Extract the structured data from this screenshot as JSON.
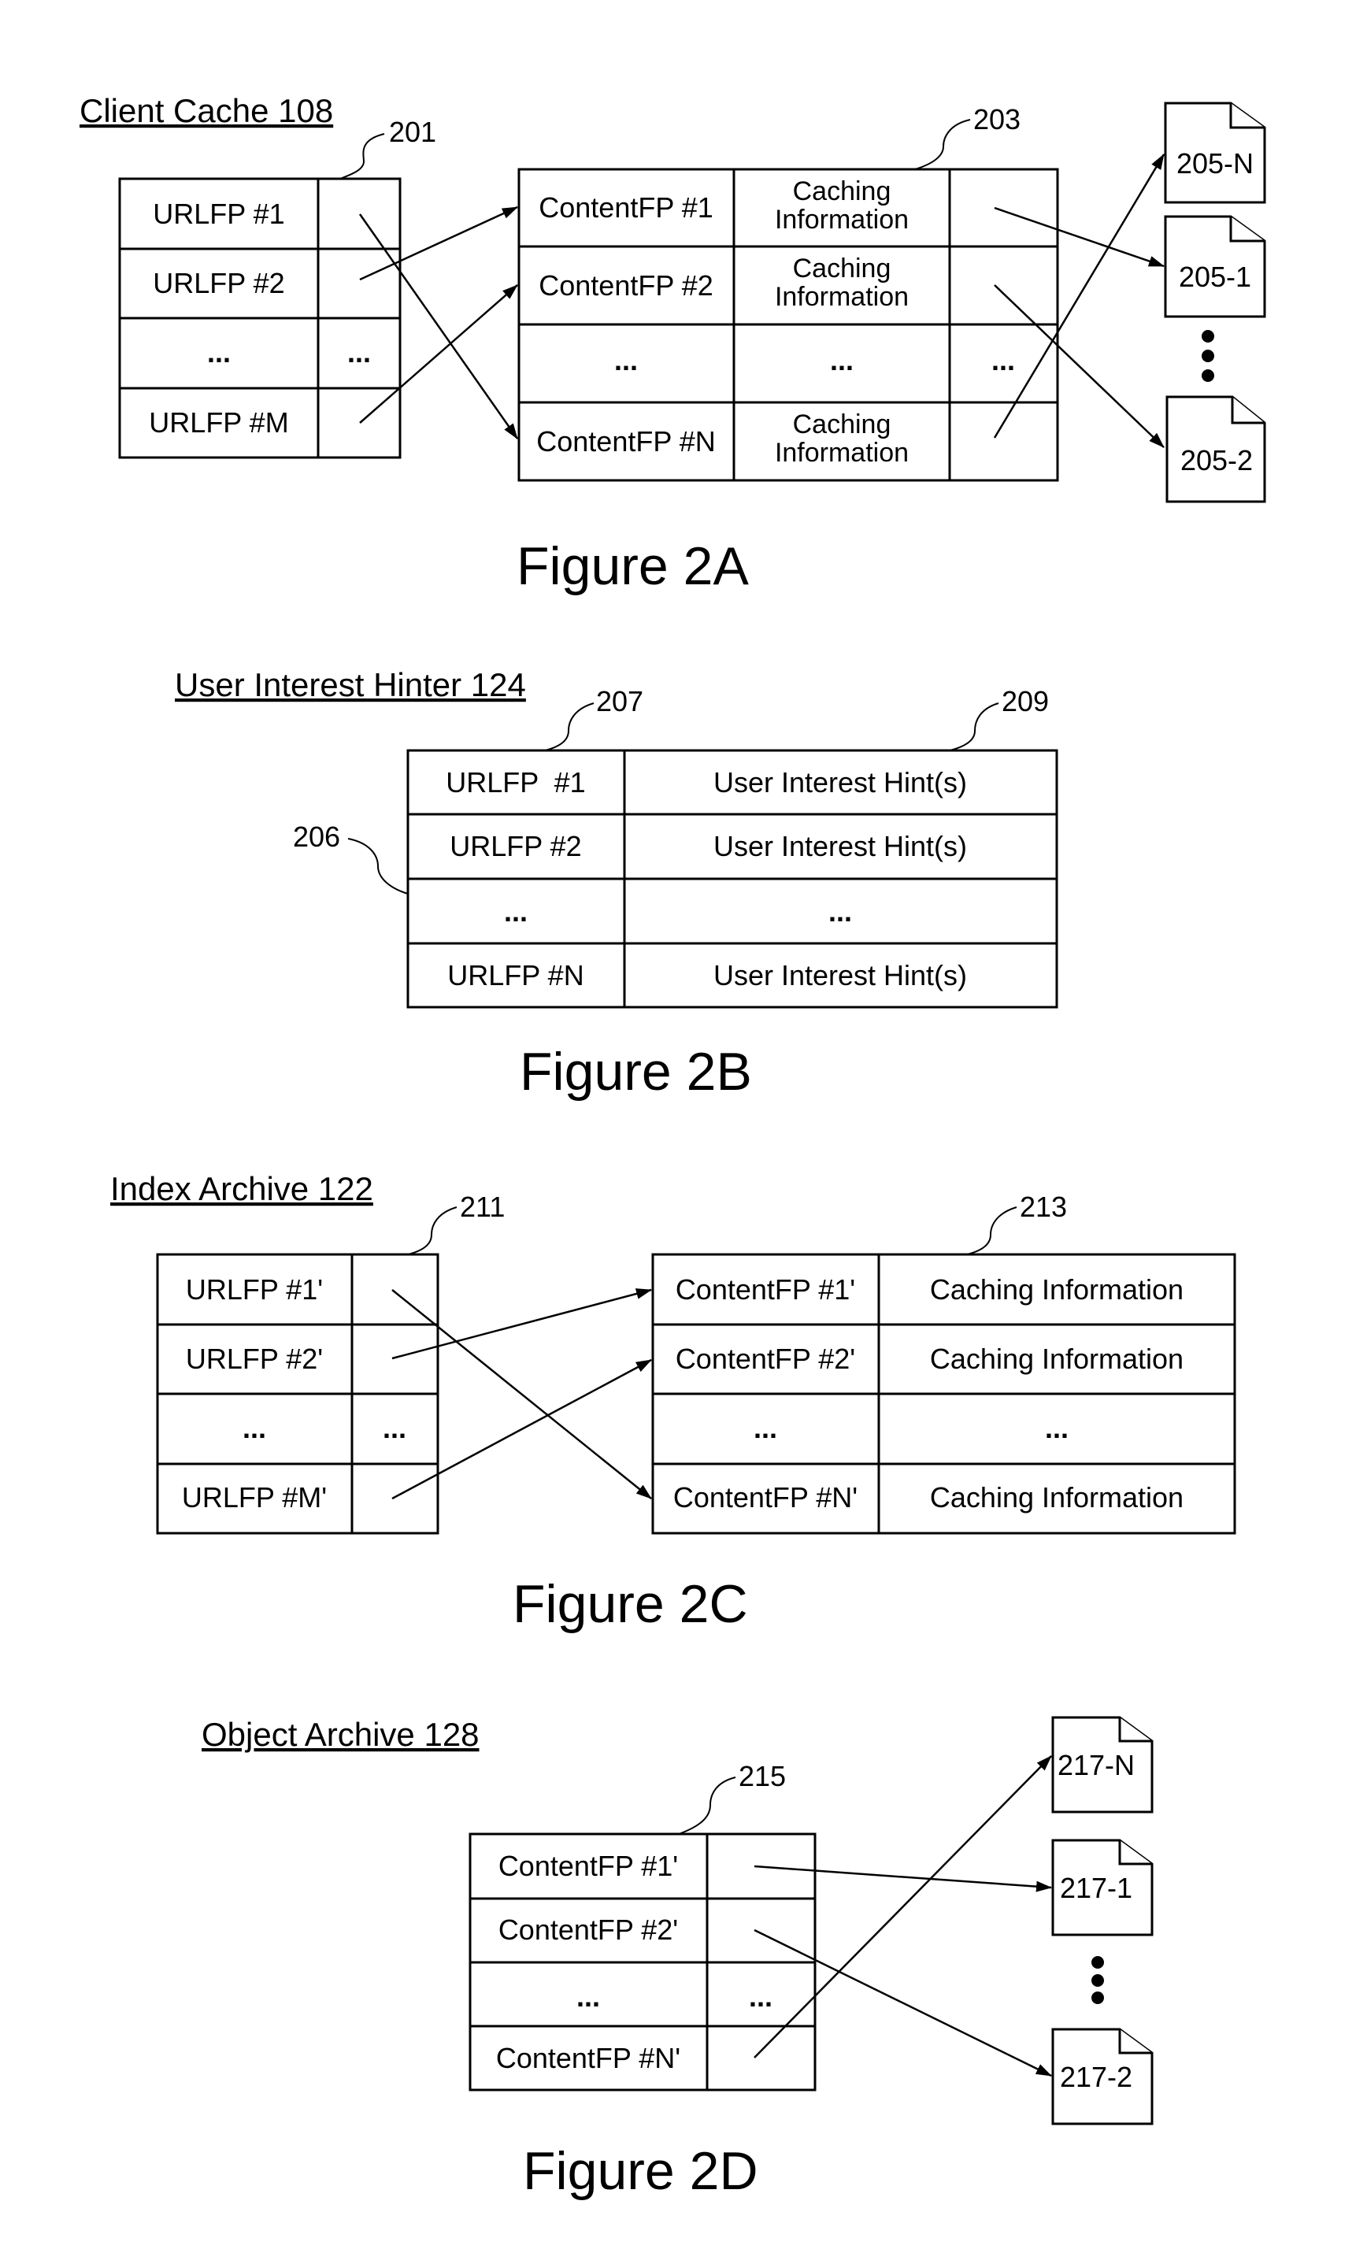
{
  "figure_2a": {
    "title": "Client Cache 108",
    "caption": "Figure 2A",
    "table_left": {
      "ref": "201",
      "rows": [
        {
          "key": "URLFP #1",
          "ptr": ""
        },
        {
          "key": "URLFP #2",
          "ptr": ""
        },
        {
          "key": "...",
          "ptr": "..."
        },
        {
          "key": "URLFP #M",
          "ptr": ""
        }
      ]
    },
    "table_right": {
      "ref": "203",
      "rows": [
        {
          "key": "ContentFP #1",
          "info": [
            "Caching",
            "Information"
          ],
          "ptr": ""
        },
        {
          "key": "ContentFP #2",
          "info": [
            "Caching",
            "Information"
          ],
          "ptr": ""
        },
        {
          "key": "...",
          "info": [
            "..."
          ],
          "ptr": "..."
        },
        {
          "key": "ContentFP #N",
          "info": [
            "Caching",
            "Information"
          ],
          "ptr": ""
        }
      ]
    },
    "documents": [
      "205-N",
      "205-1",
      "205-2"
    ],
    "mappings": [
      {
        "from": "URLFP #1",
        "to": "ContentFP #N"
      },
      {
        "from": "URLFP #2",
        "to": "ContentFP #1"
      },
      {
        "from": "URLFP #M",
        "to": "ContentFP #2"
      },
      {
        "from": "ContentFP #1",
        "to": "205-1"
      },
      {
        "from": "ContentFP #2",
        "to": "205-2"
      },
      {
        "from": "ContentFP #N",
        "to": "205-N"
      }
    ]
  },
  "figure_2b": {
    "title": "User Interest Hinter 124",
    "caption": "Figure 2B",
    "refs": {
      "row": "206",
      "col_key": "207",
      "col_hint": "209"
    },
    "rows": [
      {
        "key": "URLFP  #1",
        "hint": "User Interest Hint(s)"
      },
      {
        "key": "URLFP #2",
        "hint": "User Interest Hint(s)"
      },
      {
        "key": "...",
        "hint": "..."
      },
      {
        "key": "URLFP #N",
        "hint": "User Interest Hint(s)"
      }
    ]
  },
  "figure_2c": {
    "title": "Index Archive 122",
    "caption": "Figure 2C",
    "table_left": {
      "ref": "211",
      "rows": [
        {
          "key": "URLFP #1'",
          "ptr": ""
        },
        {
          "key": "URLFP #2'",
          "ptr": ""
        },
        {
          "key": "...",
          "ptr": "..."
        },
        {
          "key": "URLFP #M'",
          "ptr": ""
        }
      ]
    },
    "table_right": {
      "ref": "213",
      "rows": [
        {
          "key": "ContentFP #1'",
          "info": "Caching Information"
        },
        {
          "key": "ContentFP #2'",
          "info": "Caching Information"
        },
        {
          "key": "...",
          "info": "..."
        },
        {
          "key": "ContentFP #N'",
          "info": "Caching Information"
        }
      ]
    },
    "mappings": [
      {
        "from": "URLFP #1'",
        "to": "ContentFP #N'"
      },
      {
        "from": "URLFP #2'",
        "to": "ContentFP #1'"
      },
      {
        "from": "URLFP #M'",
        "to": "ContentFP #2'"
      }
    ]
  },
  "figure_2d": {
    "title": "Object Archive 128",
    "caption": "Figure 2D",
    "table": {
      "ref": "215",
      "rows": [
        {
          "key": "ContentFP #1'",
          "ptr": ""
        },
        {
          "key": "ContentFP #2'",
          "ptr": ""
        },
        {
          "key": "...",
          "ptr": "..."
        },
        {
          "key": "ContentFP #N'",
          "ptr": ""
        }
      ]
    },
    "documents": [
      "217-N",
      "217-1",
      "217-2"
    ],
    "mappings": [
      {
        "from": "ContentFP #1'",
        "to": "217-1"
      },
      {
        "from": "ContentFP #2'",
        "to": "217-2"
      },
      {
        "from": "ContentFP #N'",
        "to": "217-N"
      }
    ]
  }
}
